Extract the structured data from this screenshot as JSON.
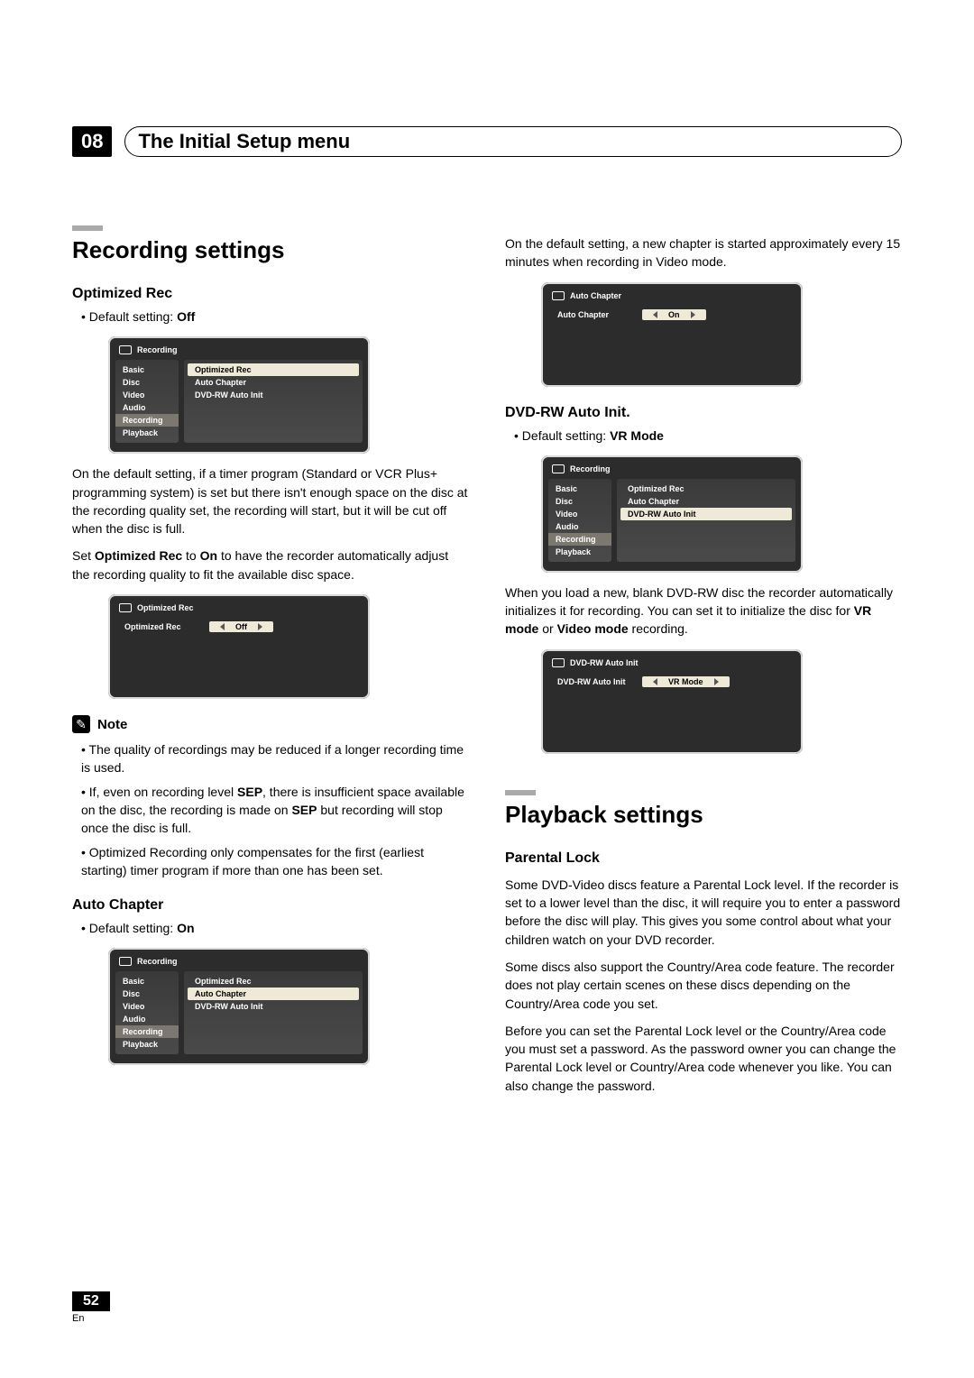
{
  "chapter": {
    "number": "08",
    "title": "The Initial Setup menu"
  },
  "sec_recording": "Recording settings",
  "sec_playback": "Playback settings",
  "optimized_rec": {
    "heading": "Optimized Rec",
    "default": "Default setting: ",
    "default_val": "Off",
    "para1a": "On the default setting, if a timer program (Standard or VCR Plus+ programming system) is set but there isn't enough space on the disc at the recording quality set, the recording will start, but it will be cut off when the disc is full.",
    "para2a": "Set ",
    "para2b": "Optimized Rec",
    "para2c": " to ",
    "para2d": "On",
    "para2e": " to have the recorder automatically adjust the recording quality to fit the available disc space."
  },
  "note": {
    "label": "Note",
    "b1": "The quality of recordings may be reduced if a longer recording time is used.",
    "b2a": "If, even on recording level ",
    "b2b": "SEP",
    "b2c": ", there is insufficient space available on the disc, the recording is made on ",
    "b2d": "SEP",
    "b2e": " but recording will stop once the disc is full.",
    "b3": "Optimized Recording only compensates for the first (earliest starting) timer program if more than one has been set."
  },
  "auto_chapter": {
    "heading": "Auto Chapter",
    "default": "Default setting: ",
    "default_val": "On",
    "para": "On the default setting, a new chapter is started approximately every 15 minutes when recording in Video mode."
  },
  "dvd_rw": {
    "heading": "DVD-RW Auto Init.",
    "default": "Default setting: ",
    "default_val": "VR Mode",
    "para_a": "When you load a new, blank DVD-RW disc the recorder automatically initializes it for recording. You can set it to initialize the disc for ",
    "para_b": "VR mode",
    "para_c": " or ",
    "para_d": "Video mode",
    "para_e": " recording."
  },
  "parental": {
    "heading": "Parental Lock",
    "p1": "Some DVD-Video discs feature a Parental Lock level. If the recorder is set to a lower level than the disc, it will require you to enter a password before the disc will play. This gives you some control about what your children watch on your DVD recorder.",
    "p2": "Some discs also support the Country/Area code feature. The recorder does not play certain scenes on these discs depending on the Country/Area code you set.",
    "p3": "Before you can set the Parental Lock level or the Country/Area code you must set a password. As the password owner you can change the Parental Lock level or Country/Area code whenever you like. You can also change the password."
  },
  "osd_recording_menu": {
    "title": "Recording",
    "left": [
      "Basic",
      "Disc",
      "Video",
      "Audio",
      "Recording",
      "Playback"
    ],
    "right": [
      "Optimized Rec",
      "Auto Chapter",
      "DVD-RW Auto Init"
    ]
  },
  "osd_opt_val": {
    "title": "Optimized Rec",
    "label": "Optimized Rec",
    "value": "Off"
  },
  "osd_auto_val": {
    "title": "Auto Chapter",
    "label": "Auto Chapter",
    "value": "On"
  },
  "osd_dvd_val": {
    "title": "DVD-RW Auto Init",
    "label": "DVD-RW Auto Init",
    "value": "VR Mode"
  },
  "page": {
    "number": "52",
    "lang": "En"
  }
}
